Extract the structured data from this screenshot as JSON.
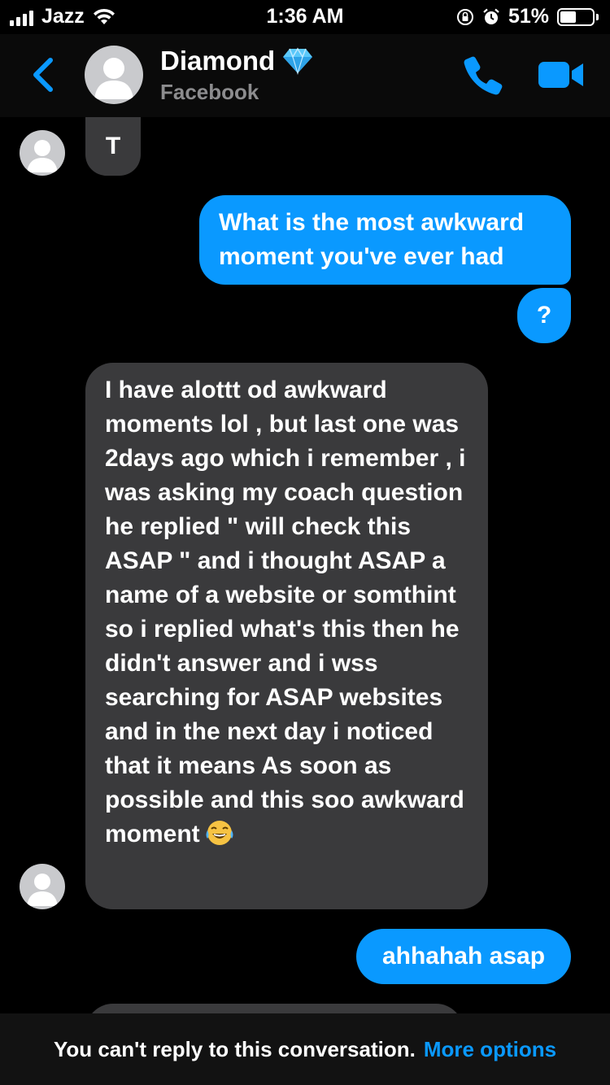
{
  "status_bar": {
    "carrier": "Jazz",
    "time": "1:36 AM",
    "battery_pct": "51%",
    "battery_level": 0.51
  },
  "header": {
    "contact_name": "Diamond",
    "contact_subtitle": "Facebook",
    "back_icon": "chevron-left-icon",
    "call_icon": "phone-icon",
    "video_icon": "video-camera-icon",
    "badge_icon": "diamond-emoji",
    "accent_color": "#0a99ff"
  },
  "messages": [
    {
      "direction": "incoming",
      "text": "T"
    },
    {
      "direction": "outgoing",
      "text": "What is the most awkward moment you've ever had"
    },
    {
      "direction": "outgoing",
      "text": "?"
    },
    {
      "direction": "incoming",
      "text": "I have alottt od awkward moments lol , but last one was 2days ago which i remember , i was asking my coach question he replied \" will check this ASAP \" and i thought ASAP  a name of a website or somthint so i replied what's this then he didn't answer and i wss searching for ASAP websites and in the next day i noticed that it means As soon as possible and this soo awkward moment",
      "emoji": "tears-of-joy-emoji"
    },
    {
      "direction": "outgoing",
      "text": "ahhahah asap"
    }
  ],
  "footer": {
    "notice": "You can't reply to this conversation.",
    "link": "More options"
  }
}
